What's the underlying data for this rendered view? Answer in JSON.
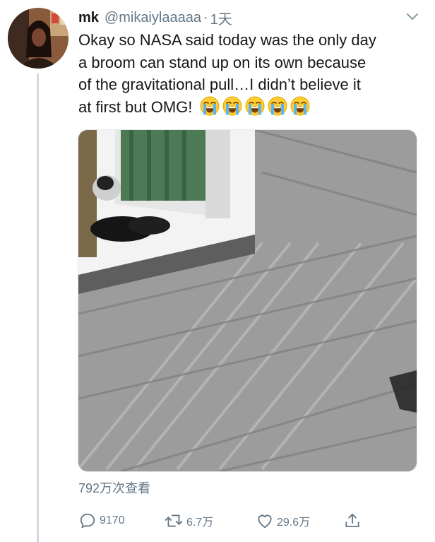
{
  "tweet": {
    "display_name": "mk",
    "handle": "@mikaiylaaaaa",
    "separator": "·",
    "time": "1天",
    "text_lines": [
      "Okay so NASA said today was the only day",
      "a broom can stand up on its own because",
      "of the gravitational pull…I didn’t believe it",
      "at first but OMG!"
    ],
    "emoji": "loudly-crying-face",
    "emoji_count": 5,
    "views": "792万次查看"
  },
  "actions": {
    "reply_count": "9170",
    "retweet_count": "6.7万",
    "like_count": "29.6万"
  },
  "colors": {
    "text": "#14171a",
    "secondary": "#657786",
    "thread_line": "#cfd9de"
  }
}
